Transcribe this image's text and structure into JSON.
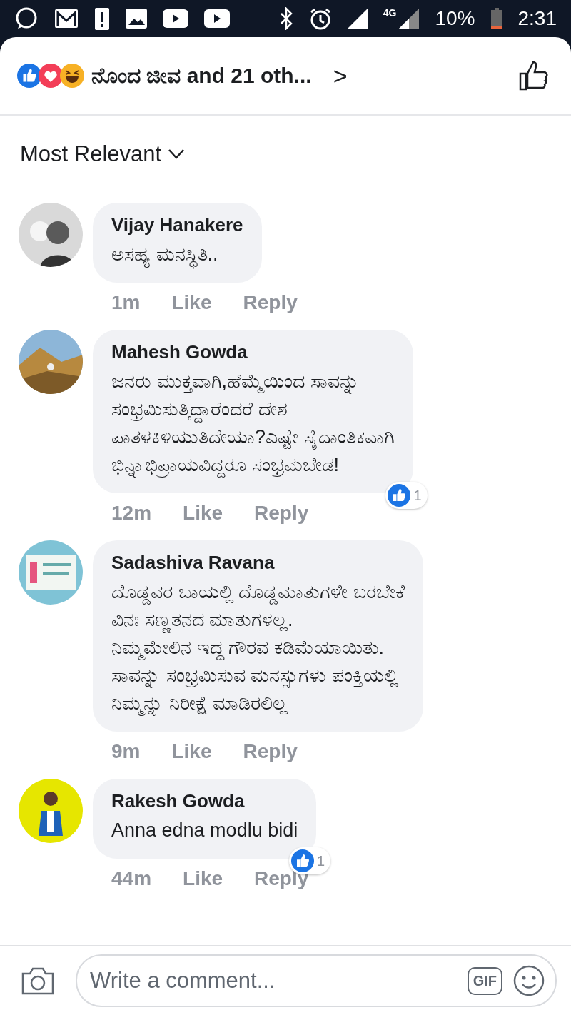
{
  "status_bar": {
    "network": "4G",
    "battery": "10%",
    "time": "2:31"
  },
  "header": {
    "reactors": "ನೊಂದ ಜೀವ and 21 oth...",
    "chevron": ">"
  },
  "sort": {
    "label": "Most Relevant"
  },
  "comments": [
    {
      "author": "Vijay Hanakere",
      "lines": [
        "ಅಸಹ್ಯ ಮನಸ್ಥಿತಿ.."
      ],
      "time": "1m",
      "like": "Like",
      "reply": "Reply"
    },
    {
      "author": "Mahesh Gowda",
      "lines": [
        "ಜನರು ಮುಕ್ತವಾಗಿ,ಹೆಮ್ಮೆಯಿಂದ ಸಾವನ್ನು",
        "ಸಂಭ್ರಮಿಸುತ್ತಿದ್ದಾರೆಂದರೆ ದೇಶ",
        "ಪಾತಳಕಿಳಿಯುತಿದೇಯಾ?ಎಷ್ಟೇ ಸೈದಾಂತಿಕವಾಗಿ",
        "ಭಿನ್ನಾಭಿಪ್ರಾಯವಿದ್ದರೂ ಸಂಭ್ರಮಬೇಡ!"
      ],
      "time": "12m",
      "like": "Like",
      "reply": "Reply",
      "reactions": "1"
    },
    {
      "author": "Sadashiva Ravana",
      "lines": [
        "ದೊಡ್ಡವರ ಬಾಯಲ್ಲಿ ದೊಡ್ಡಮಾತುಗಳೇ ಬರಬೇಕೆ",
        "ವಿನಃ ಸಣ್ಣತನದ ಮಾತುಗಳಲ್ಲ.",
        "ನಿಮ್ಮಮೇಲಿನ ಇದ್ದ ಗೌರವ ಕಡಿಮೆಯಾಯಿತು.",
        "ಸಾವನ್ನು ಸಂಭ್ರಮಿಸುವ ಮನಸ್ಸುಗಳು ಪಂಕ್ತಿಯಲ್ಲಿ",
        "ನಿಮ್ಮನ್ನು ನಿರೀಕ್ಷೆ ಮಾಡಿರಲಿಲ್ಲ"
      ],
      "time": "9m",
      "like": "Like",
      "reply": "Reply"
    },
    {
      "author": "Rakesh Gowda",
      "lines": [
        "Anna edna modlu bidi"
      ],
      "time": "44m",
      "like": "Like",
      "reply": "Reply",
      "reactions": "1"
    }
  ],
  "composer": {
    "placeholder": "Write a comment...",
    "gif": "GIF"
  }
}
